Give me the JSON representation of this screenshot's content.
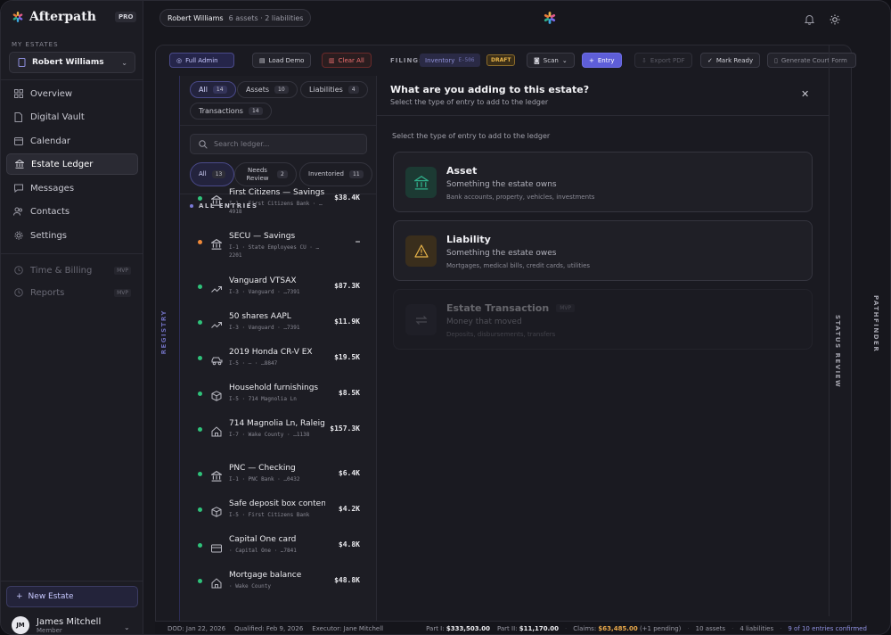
{
  "app": {
    "name": "Afterpath",
    "badge": "PRO"
  },
  "sidebar": {
    "section_label": "MY ESTATES",
    "estate_selector": "Robert Williams",
    "nav": [
      {
        "label": "Overview",
        "icon": "grid-icon"
      },
      {
        "label": "Digital Vault",
        "icon": "file-icon"
      },
      {
        "label": "Calendar",
        "icon": "calendar-icon"
      },
      {
        "label": "Estate Ledger",
        "icon": "bank-icon",
        "active": true
      },
      {
        "label": "Messages",
        "icon": "chat-icon"
      },
      {
        "label": "Contacts",
        "icon": "people-icon"
      },
      {
        "label": "Settings",
        "icon": "gear-icon"
      }
    ],
    "nav_disabled": [
      {
        "label": "Time & Billing",
        "badge": "MVP"
      },
      {
        "label": "Reports",
        "badge": "MVP"
      }
    ],
    "new_estate": "New Estate",
    "user": {
      "initials": "JM",
      "name": "James Mitchell",
      "role": "Member"
    }
  },
  "topbar": {
    "estate": "Robert Williams",
    "summary": "6 assets · 2 liabilities"
  },
  "toolbar": {
    "full_admin": "Full Admin",
    "load_demo": "Load Demo",
    "clear_all": "Clear All",
    "filing_label": "FILING:",
    "filing_value": "Inventory",
    "filing_code": "E-506",
    "status": "DRAFT",
    "scan": "Scan",
    "entry": "Entry",
    "export": "Export PDF",
    "mark_ready": "Mark Ready",
    "court_form": "Generate Court Form"
  },
  "registry_label": "REGISTRY",
  "filters": {
    "type": [
      {
        "label": "All",
        "count": "14"
      },
      {
        "label": "Assets",
        "count": "10"
      },
      {
        "label": "Liabilities",
        "count": "4"
      },
      {
        "label": "Transactions",
        "count": "14"
      }
    ],
    "search_placeholder": "Search ledger...",
    "status": [
      {
        "label": "All",
        "count": "13"
      },
      {
        "label": "Needs Review",
        "count": "2"
      },
      {
        "label": "Inventoried",
        "count": "11"
      }
    ]
  },
  "list_header": "ALL ENTRIES",
  "entries": [
    {
      "name": "First Citizens — Savings",
      "sub": "I-1 · First Citizens Bank · …4918",
      "amount": "$38.4K",
      "status": "green",
      "icon": "bank-icon"
    },
    {
      "name": "SECU — Savings",
      "sub": "I-1 · State Employees CU · …2201",
      "amount": "—",
      "status": "orange",
      "icon": "bank-icon"
    },
    {
      "name": "Vanguard VTSAX",
      "sub": "I-3 · Vanguard · …7391",
      "amount": "$87.3K",
      "status": "green",
      "icon": "trend-icon"
    },
    {
      "name": "50 shares AAPL",
      "sub": "I-3 · Vanguard · …7391",
      "amount": "$11.9K",
      "status": "green",
      "icon": "trend-icon"
    },
    {
      "name": "2019 Honda CR-V EX",
      "sub": "I-5 · — · …8847",
      "amount": "$19.5K",
      "status": "green",
      "icon": "car-icon"
    },
    {
      "name": "Household furnishings",
      "sub": "I-5 · 714 Magnolia Ln",
      "amount": "$8.5K",
      "status": "green",
      "icon": "box-icon"
    },
    {
      "name": "714 Magnolia Ln, Raleigh",
      "sub": "I-7 · Wake County · …1138",
      "amount": "$157.3K",
      "status": "green",
      "icon": "home-icon"
    },
    {
      "name": "PNC — Checking",
      "sub": "I-1 · PNC Bank · …0432",
      "amount": "$6.4K",
      "status": "green",
      "icon": "bank-icon"
    },
    {
      "name": "Safe deposit box contents",
      "sub": "I-5 · First Citizens Bank",
      "amount": "$4.2K",
      "status": "green",
      "icon": "box-icon"
    },
    {
      "name": "Capital One card",
      "sub": "· Capital One · …7841",
      "amount": "$4.8K",
      "status": "green",
      "icon": "card-icon"
    },
    {
      "name": "Mortgage balance",
      "sub": "· Wake County",
      "amount": "$48.8K",
      "status": "green",
      "icon": "home-icon"
    }
  ],
  "dialog": {
    "title": "What are you adding to this estate?",
    "subtitle": "Select the type of entry to add to the ledger",
    "instruction": "Select the type of entry to add to the ledger",
    "options": [
      {
        "title": "Asset",
        "subtitle": "Something the estate owns",
        "detail": "Bank accounts, property, vehicles, investments",
        "icon": "bank-icon",
        "color": "#2fae8a"
      },
      {
        "title": "Liability",
        "subtitle": "Something the estate owes",
        "detail": "Mortgages, medical bills, credit cards, utilities",
        "icon": "warning-icon",
        "color": "#e8b44a"
      },
      {
        "title": "Estate Transaction",
        "badge": "MVP",
        "subtitle": "Money that moved",
        "detail": "Deposits, disbursements, transfers",
        "icon": "swap-icon",
        "color": "#8a8a95"
      }
    ]
  },
  "rails": {
    "status_review": "STATUS REVIEW",
    "pathfinder": "PATHFINDER"
  },
  "footer": {
    "dod": "DOD: Jan 22, 2026",
    "qualified": "Qualified: Feb 9, 2026",
    "executor": "Executor: Jane Mitchell",
    "part1_label": "Part I:",
    "part1_value": "$333,503.00",
    "part2_label": "Part II:",
    "part2_value": "$11,170.00",
    "claims_label": "Claims:",
    "claims_value": "$63,485.00",
    "claims_pending": "(+1 pending)",
    "assets": "10 assets",
    "liabilities": "4 liabilities",
    "confirmed": "9 of 10 entries confirmed"
  }
}
